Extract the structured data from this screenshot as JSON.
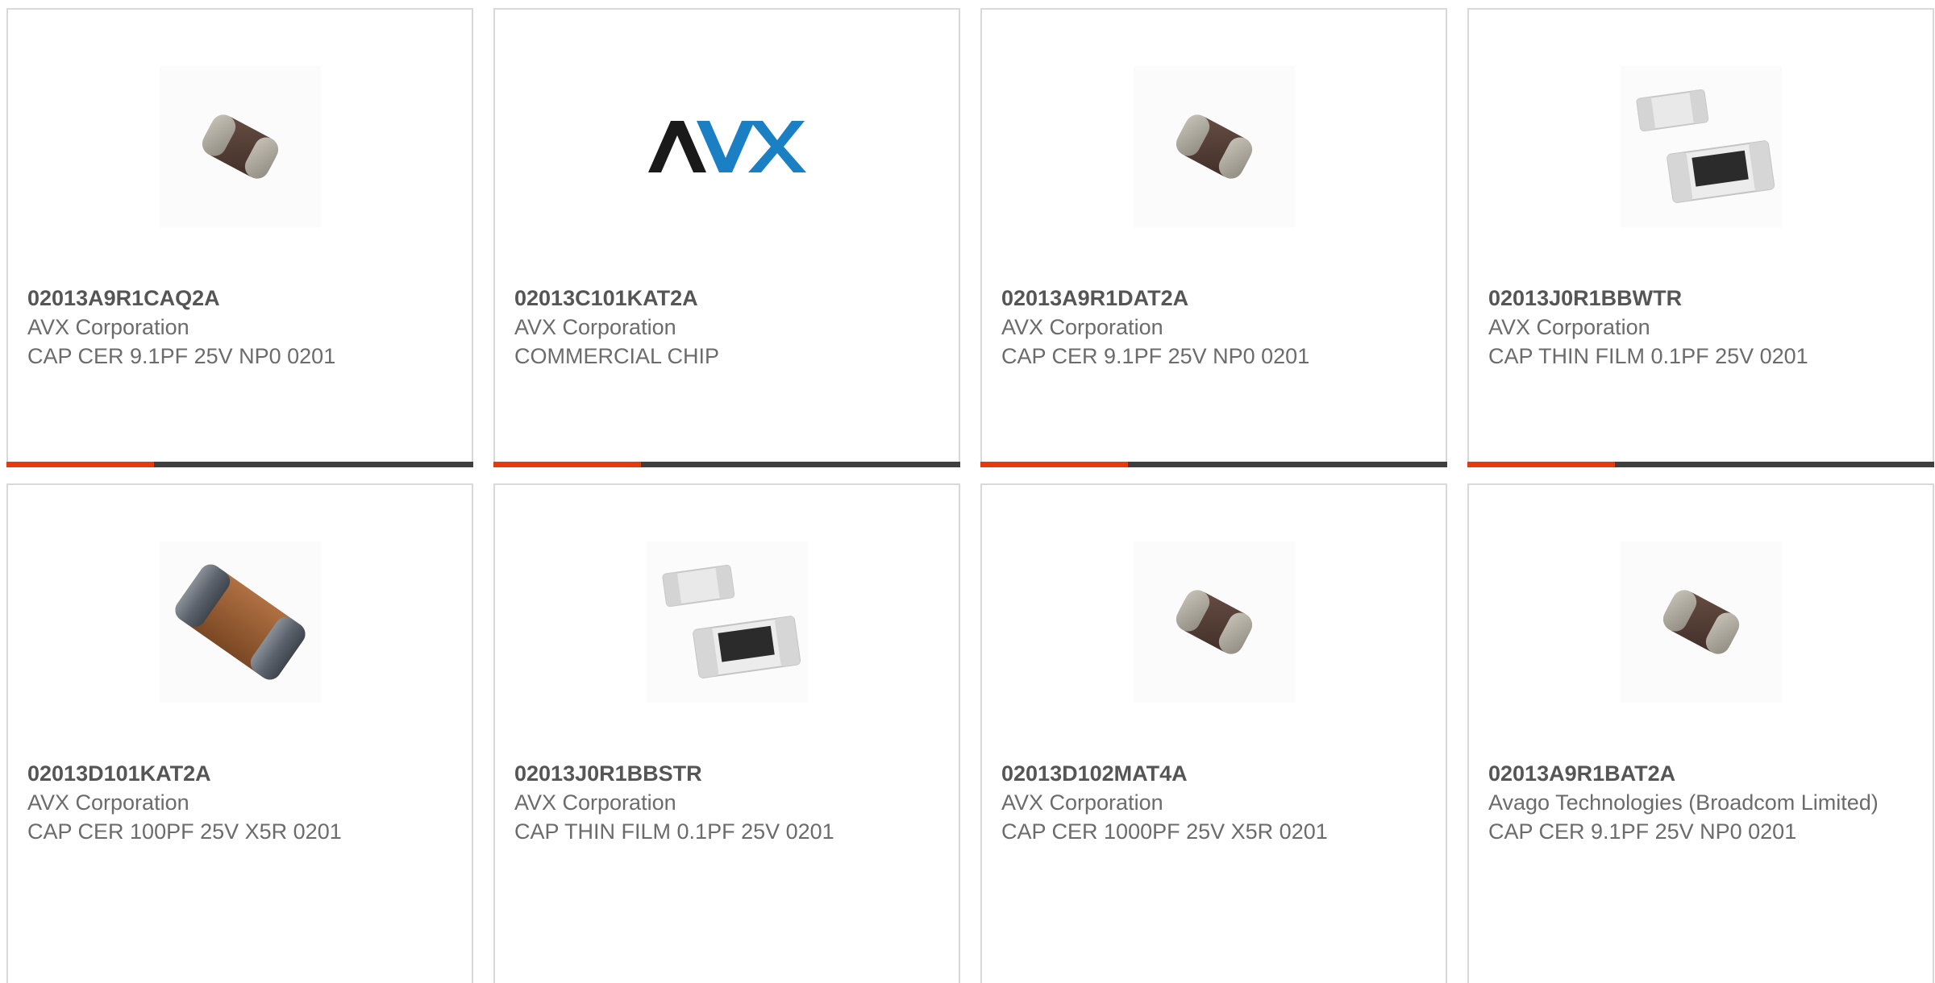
{
  "products": [
    {
      "part_number": "02013A9R1CAQ2A",
      "manufacturer": "AVX Corporation",
      "description": "CAP CER 9.1PF 25V NP0 0201",
      "image": "ceramic-chip-capacitor-icon",
      "has_bar": true
    },
    {
      "part_number": "02013C101KAT2A",
      "manufacturer": "AVX Corporation",
      "description": "COMMERCIAL CHIP",
      "image": "avx-logo",
      "logo_text": "AVX",
      "has_bar": true
    },
    {
      "part_number": "02013A9R1DAT2A",
      "manufacturer": "AVX Corporation",
      "description": "CAP CER 9.1PF 25V NP0 0201",
      "image": "ceramic-chip-capacitor-icon",
      "has_bar": true
    },
    {
      "part_number": "02013J0R1BBWTR",
      "manufacturer": "AVX Corporation",
      "description": "CAP THIN FILM 0.1PF 25V 0201",
      "image": "thin-film-chip-capacitor-icon",
      "has_bar": true
    },
    {
      "part_number": "02013D101KAT2A",
      "manufacturer": "AVX Corporation",
      "description": "CAP CER 100PF 25V X5R 0201",
      "image": "mlcc-chip-capacitor-icon",
      "has_bar": false
    },
    {
      "part_number": "02013J0R1BBSTR",
      "manufacturer": "AVX Corporation",
      "description": "CAP THIN FILM 0.1PF 25V 0201",
      "image": "thin-film-chip-capacitor-icon",
      "has_bar": false
    },
    {
      "part_number": "02013D102MAT4A",
      "manufacturer": "AVX Corporation",
      "description": "CAP CER 1000PF 25V X5R 0201",
      "image": "ceramic-chip-capacitor-icon",
      "has_bar": false
    },
    {
      "part_number": "02013A9R1BAT2A",
      "manufacturer": "Avago Technologies (Broadcom Limited)",
      "description": "CAP CER 9.1PF 25V NP0 0201",
      "image": "ceramic-chip-capacitor-icon",
      "has_bar": false
    }
  ],
  "colors": {
    "accent": "#e8380d",
    "bar": "#3f3f3f",
    "border": "#d9d9d9",
    "text": "#6b6b6b",
    "avx_blue": "#1b7fc4"
  }
}
